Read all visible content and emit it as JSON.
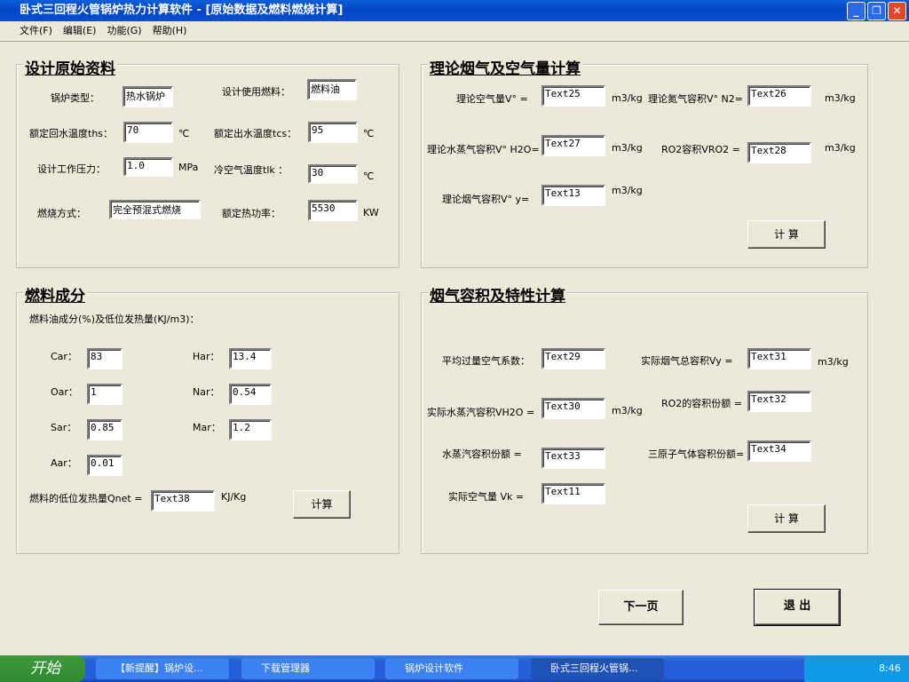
{
  "window": {
    "title": "卧式三回程火管锅炉热力计算软件 - [原始数据及燃料燃烧计算]",
    "minimize": "_",
    "restore": "❐",
    "close": "✕"
  },
  "menu": [
    "文件(F)",
    "编辑(E)",
    "功能(G)",
    "帮助(H)"
  ],
  "design": {
    "title": "设计原始资料",
    "boiler_type_label": "锅炉类型：",
    "boiler_type": "热水锅炉",
    "fuel_label": "设计使用燃料：",
    "fuel": "燃料油",
    "return_temp_label": "额定回水温度ths：",
    "return_temp": "70",
    "unit_c": "℃",
    "outlet_temp_label": "额定出水温度tcs：",
    "outlet_temp": "95",
    "pressure_label": "设计工作压力：",
    "pressure": "1.0",
    "unit_mpa": "MPa",
    "cold_air_label": "冷空气温度tlk ：",
    "cold_air": "30",
    "combustion_label": "燃烧方式：",
    "combustion": "完全预混式燃烧",
    "power_label": "额定热功率：",
    "power": "5530",
    "unit_kw": "KW"
  },
  "theory": {
    "title": "理论烟气及空气量计算",
    "unit": "m3/kg",
    "v0_label": "理论空气量V°  =",
    "v0": "Text25",
    "vn2_label": "理论氮气容积V° N2=",
    "vn2": "Text26",
    "vh2o_label": "理论水蒸气容积V° H2O=",
    "vh2o": "Text27",
    "vro2_label": "RO2容积VRO2 =",
    "vro2": "Text28",
    "vy_label": "理论烟气容积V° y=",
    "vy": "Text13",
    "calc": "计  算"
  },
  "fuel": {
    "title": "燃料成分",
    "subtitle": "燃料油成分(%)及低位发热量(KJ/m3)：",
    "car_label": "Car：",
    "car": "83",
    "har_label": "Har：",
    "har": "13.4",
    "oar_label": "Oar：",
    "oar": "1",
    "nar_label": "Nar：",
    "nar": "0.54",
    "sar_label": "Sar：",
    "sar": "0.85",
    "mar_label": "Mar：",
    "mar": "1.2",
    "aar_label": "Aar：",
    "aar": "0.01",
    "qnet_label": "燃料的低位发热量Qnet =",
    "qnet": "Text38",
    "qnet_unit": "KJ/Kg",
    "calc": "计算"
  },
  "flue": {
    "title": "烟气容积及特性计算",
    "unit": "m3/kg",
    "alpha_label": "平均过量空气系数：",
    "alpha": "Text29",
    "vy_label": "实际烟气总容积Vy =",
    "vy": "Text31",
    "vh2o_label": "实际水蒸汽容积VH2O =",
    "vh2o": "Text30",
    "rro2_label": "RO2的容积份额 =",
    "rro2": "Text32",
    "rh2o_label": "水蒸汽容积份额 =",
    "rh2o": "Text33",
    "rn_label": "三原子气体容积份额=",
    "rn": "Text34",
    "vk_label": "实际空气量 Vk =",
    "vk": "Text11",
    "calc": "计  算"
  },
  "buttons": {
    "next": "下一页",
    "exit": "退 出"
  },
  "taskbar": {
    "start": "开始",
    "tasks": [
      "【新提醒】锅炉设...",
      "下载管理器",
      "锅炉设计软件",
      "卧式三回程火管锅..."
    ],
    "clock": "8:46"
  }
}
